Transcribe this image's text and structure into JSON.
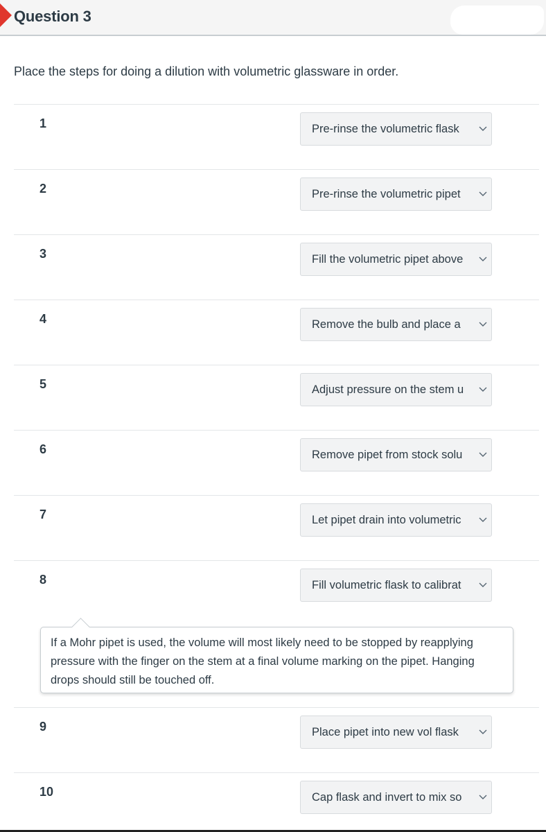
{
  "header": {
    "title": "Question 3",
    "status_flag_color": "#e0362d"
  },
  "prompt": "Place the steps for doing a dilution with volumetric glassware in order.",
  "rows": [
    {
      "number": "1",
      "selected": "Pre-rinse the volumetric flask"
    },
    {
      "number": "2",
      "selected": "Pre-rinse the volumetric pipet"
    },
    {
      "number": "3",
      "selected": "Fill the volumetric pipet above"
    },
    {
      "number": "4",
      "selected": "Remove the bulb and place a"
    },
    {
      "number": "5",
      "selected": "Adjust pressure on the stem u"
    },
    {
      "number": "6",
      "selected": "Remove pipet from stock solu"
    },
    {
      "number": "7",
      "selected": "Let pipet drain into volumetric"
    },
    {
      "number": "8",
      "selected": "Fill volumetric flask to calibrat"
    },
    {
      "number": "9",
      "selected": "Place pipet into new vol flask"
    },
    {
      "number": "10",
      "selected": "Cap flask and invert to mix so"
    }
  ],
  "feedback": {
    "after_row": 8,
    "text": "If a Mohr pipet is used, the volume will most likely need to be stopped by reapplying pressure with the finger on the stem at a final volume marking on the pipet.  Hanging drops should still be touched off."
  },
  "icons": {
    "dropdown": "chevron-down-icon",
    "flag": "question-flag-icon"
  }
}
